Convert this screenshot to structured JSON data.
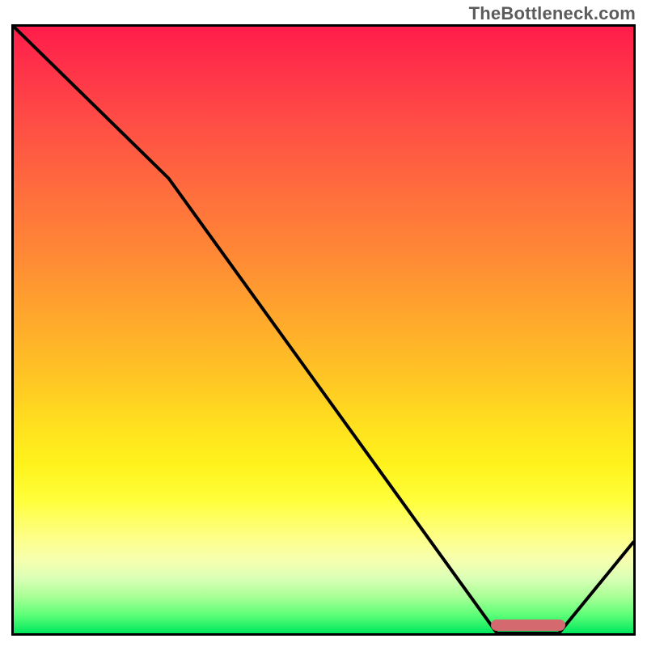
{
  "watermark": "TheBottleneck.com",
  "colors": {
    "frame": "#000000",
    "curve": "#000000",
    "marker": "#d46a6f",
    "gradient_stops": [
      "#ff1d4a",
      "#ff2f49",
      "#ff4846",
      "#ff6a3e",
      "#ff8a35",
      "#ffa82c",
      "#ffc624",
      "#ffe11e",
      "#fff21c",
      "#ffff3a",
      "#feff85",
      "#f6ffb0",
      "#d9ffb5",
      "#a8ff96",
      "#5dff78",
      "#00e75d"
    ]
  },
  "chart_data": {
    "type": "line",
    "title": "",
    "xlabel": "",
    "ylabel": "",
    "xlim": [
      0,
      100
    ],
    "ylim": [
      0,
      100
    ],
    "grid": false,
    "legend": false,
    "series": [
      {
        "name": "bottleneck-curve",
        "x": [
          0,
          25,
          78,
          88,
          100
        ],
        "y": [
          100,
          75,
          0,
          0,
          15
        ]
      }
    ],
    "marker": {
      "name": "target-range",
      "x_start": 77,
      "x_end": 89,
      "y": 1
    },
    "notes": "V-shaped bottleneck curve over a red→green vertical gradient; no axis ticks or labels are shown."
  }
}
